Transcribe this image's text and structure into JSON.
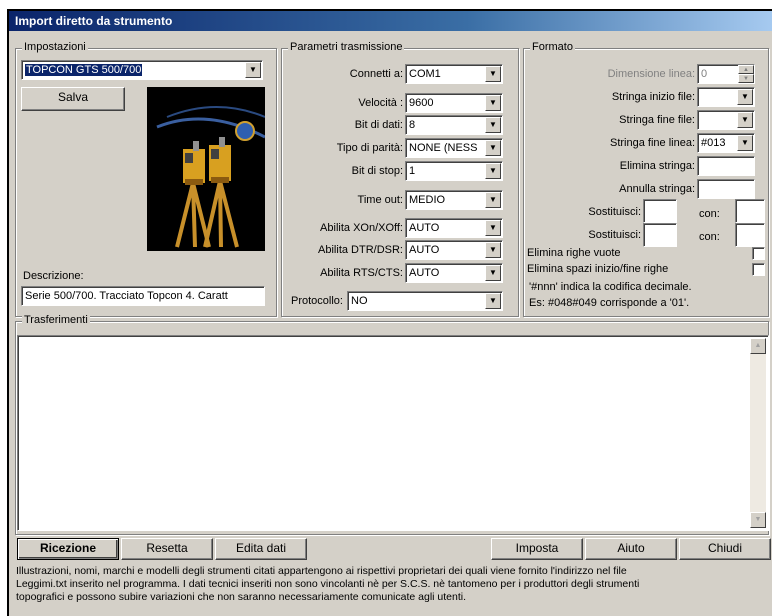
{
  "window": {
    "title": "Import diretto da strumento"
  },
  "impostazioni": {
    "group_label": "Impostazioni",
    "instrument_value": "TOPCON GTS 500/700",
    "save_label": "Salva",
    "description_label": "Descrizione:",
    "description_value": "Serie 500/700. Tracciato Topcon 4. Caratt"
  },
  "trasmissione": {
    "group_label": "Parametri trasmissione",
    "rows": [
      {
        "label": "Connetti a:",
        "value": "COM1"
      },
      {
        "label": "Velocità :",
        "value": "9600"
      },
      {
        "label": "Bit di dati:",
        "value": "8"
      },
      {
        "label": "Tipo di parità:",
        "value": "NONE (NESS"
      },
      {
        "label": "Bit di stop:",
        "value": "1"
      },
      {
        "label": "Time out:",
        "value": "MEDIO"
      },
      {
        "label": "Abilita XOn/XOff:",
        "value": "AUTO"
      },
      {
        "label": "Abilita DTR/DSR:",
        "value": "AUTO"
      },
      {
        "label": "Abilita RTS/CTS:",
        "value": "AUTO"
      },
      {
        "label": "Protocollo:",
        "value": "NO"
      }
    ]
  },
  "formato": {
    "group_label": "Formato",
    "dimensione_label": "Dimensione linea:",
    "dimensione_value": "0",
    "inizio_file_label": "Stringa inizio file:",
    "inizio_file_value": "",
    "fine_file_label": "Stringa fine file:",
    "fine_file_value": "",
    "fine_linea_label": "Stringa fine linea:",
    "fine_linea_value": "#013",
    "elimina_label": "Elimina stringa:",
    "annulla_label": "Annulla stringa:",
    "sostituisci_label": "Sostituisci:",
    "con_label": "con:",
    "elimina_righe_label": "Elimina righe vuote",
    "elimina_spazi_label": "Elimina spazi inizio/fine righe",
    "note_line1": "'#nnn' indica la codifica decimale.",
    "note_line2": "Es: #048#049 corrisponde a '01'."
  },
  "trasferimenti": {
    "group_label": "Trasferimenti"
  },
  "buttons": {
    "ricezione": "Ricezione",
    "resetta": "Resetta",
    "edita": "Edita dati",
    "imposta": "Imposta",
    "aiuto": "Aiuto",
    "chiudi": "Chiudi"
  },
  "footer": {
    "line1": "Illustrazioni, nomi, marchi e modelli degli strumenti citati appartengono ai rispettivi proprietari dei quali viene fornito l'indirizzo nel file",
    "line2": "Leggimi.txt inserito nel programma. I dati tecnici inseriti non sono vincolanti nè per S.C.S. nè tantomeno per i produttori degli strumenti",
    "line3": "topografici e possono subire variazioni che non saranno necessariamente comunicate agli utenti."
  },
  "icons": {
    "dropdown": "chevron-down-icon",
    "scroll_up": "scroll-up-icon",
    "scroll_down": "scroll-down-icon",
    "spin_up": "spin-up-icon",
    "spin_down": "spin-down-icon"
  },
  "colors": {
    "title_start": "#0a246a",
    "title_end": "#a6caf0",
    "face": "#d4d0c8"
  }
}
